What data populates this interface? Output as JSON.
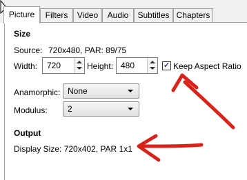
{
  "tabs": [
    {
      "label": "Picture",
      "active": true
    },
    {
      "label": "Filters"
    },
    {
      "label": "Video"
    },
    {
      "label": "Audio"
    },
    {
      "label": "Subtitles"
    },
    {
      "label": "Chapters"
    }
  ],
  "size": {
    "heading": "Size",
    "source_label": "Source:",
    "source_value": "720x480, PAR: 89/75",
    "width_label": "Width:",
    "width_value": "720",
    "height_label": "Height:",
    "height_value": "480",
    "keep_aspect_label": "Keep Aspect Ratio",
    "keep_aspect_checked": true,
    "anamorphic_label": "Anamorphic:",
    "anamorphic_value": "None",
    "modulus_label": "Modulus:",
    "modulus_value": "2"
  },
  "output": {
    "heading": "Output",
    "display_size": "Display Size: 720x402,  PAR 1x1"
  },
  "annotation_color": "#d9231a"
}
